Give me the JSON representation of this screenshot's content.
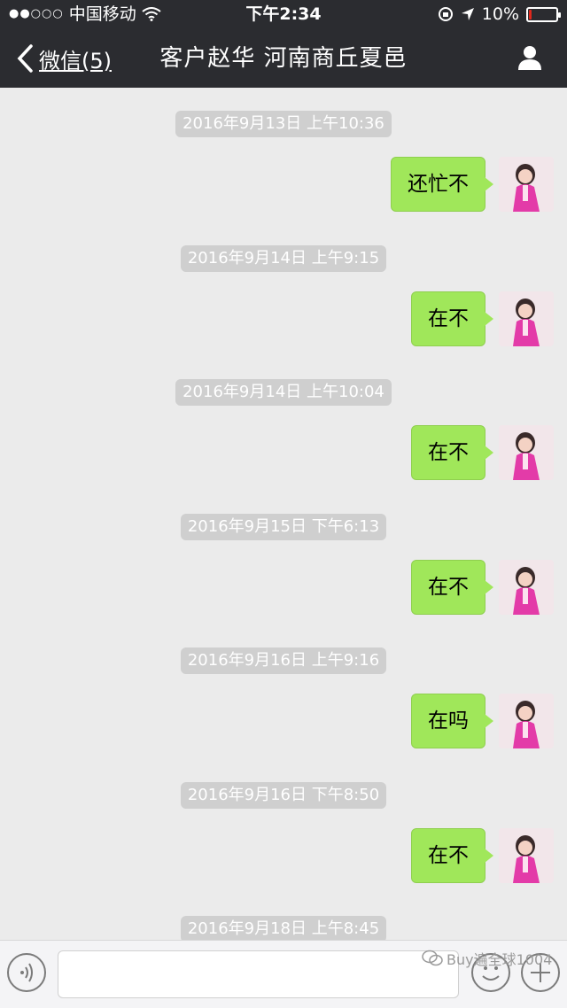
{
  "status_bar": {
    "signal": "●●○○○",
    "carrier": "中国移动",
    "time": "下午2:34",
    "battery_percent": "10%",
    "battery_level": 0.1
  },
  "nav": {
    "back_label": "微信(5)",
    "title": "客户赵华 河南商丘夏邑"
  },
  "messages": [
    {
      "timestamp": "2016年9月13日 上午10:36",
      "text": "还忙不"
    },
    {
      "timestamp": "2016年9月14日 上午9:15",
      "text": "在不"
    },
    {
      "timestamp": "2016年9月14日 上午10:04",
      "text": "在不"
    },
    {
      "timestamp": "2016年9月15日 下午6:13",
      "text": "在不"
    },
    {
      "timestamp": "2016年9月16日 上午9:16",
      "text": "在吗"
    },
    {
      "timestamp": "2016年9月16日 下午8:50",
      "text": "在不"
    },
    {
      "timestamp": "2016年9月18日 上午8:45",
      "text": ""
    }
  ],
  "watermark": "Buy遍全球1004",
  "colors": {
    "header_bg": "#2b2c30",
    "chat_bg": "#ebebeb",
    "bubble_green": "#a0e75a",
    "timestamp_bg": "#cfcfcf"
  }
}
